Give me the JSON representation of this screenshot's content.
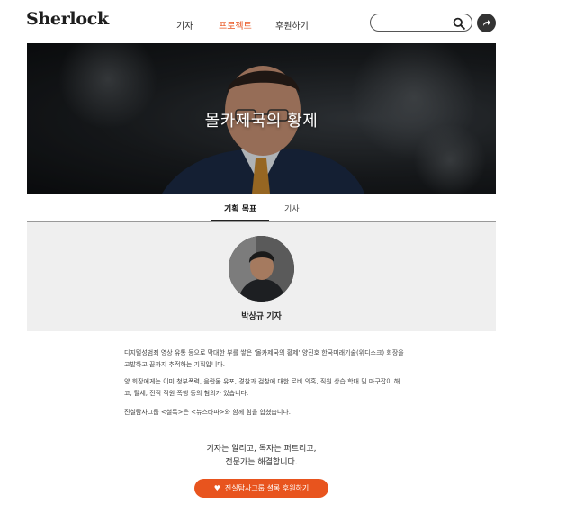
{
  "header": {
    "logo": "Sherlock",
    "nav": [
      {
        "label": "기자"
      },
      {
        "label": "프로젝트"
      },
      {
        "label": "후원하기"
      }
    ],
    "search_placeholder": ""
  },
  "hero": {
    "title": "몰카제국의 황제"
  },
  "tabs": [
    {
      "label": "기획 목표"
    },
    {
      "label": "기사"
    }
  ],
  "reporter": {
    "name": "박상규 기자"
  },
  "body": {
    "p1_line1": "디지털성범죄 영상 유통 등으로 막대한 부를 쌓은 '몰카제국의 황제' 양진호 한국미래기술(위디스크) 회장을",
    "p1_line2": "고발하고 끝까지 추적하는 기획입니다.",
    "p2_line1": "양 회장에게는 이미 청부폭력, 음란물 유포, 경찰과 검찰에 대한 로비 의혹, 직원 상습 학대 및 마구잡이 해",
    "p2_line2": "고, 탈세, 전직 직원 폭행 등의 혐의가 있습니다.",
    "p3": "진실탐사그룹 <셜록>은 <뉴스타파>와 함께 힘을 합쳤습니다."
  },
  "slogan": {
    "line1": "기자는 알리고, 독자는 퍼트리고,",
    "line2": "전문가는 해결합니다."
  },
  "cta": {
    "label": "진실탐사그룹 셜록 후원하기"
  },
  "colors": {
    "accent": "#e8541e",
    "band": "#efefef"
  }
}
